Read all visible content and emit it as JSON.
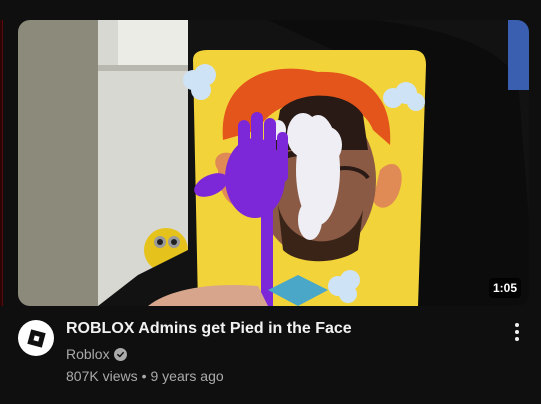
{
  "video": {
    "title": "ROBLOX Admins get Pied in the Face",
    "duration": "1:05",
    "channel": "Roblox",
    "views": "807K views",
    "separator": "•",
    "age": "9 years ago",
    "verified": true
  },
  "icons": {
    "avatar": "roblox-logo-icon",
    "verified": "verified-check-icon",
    "menu": "more-vert-icon"
  },
  "colors": {
    "background": "#0f0f0f",
    "primary_text": "#f1f1f1",
    "secondary_text": "#aaaaaa"
  }
}
